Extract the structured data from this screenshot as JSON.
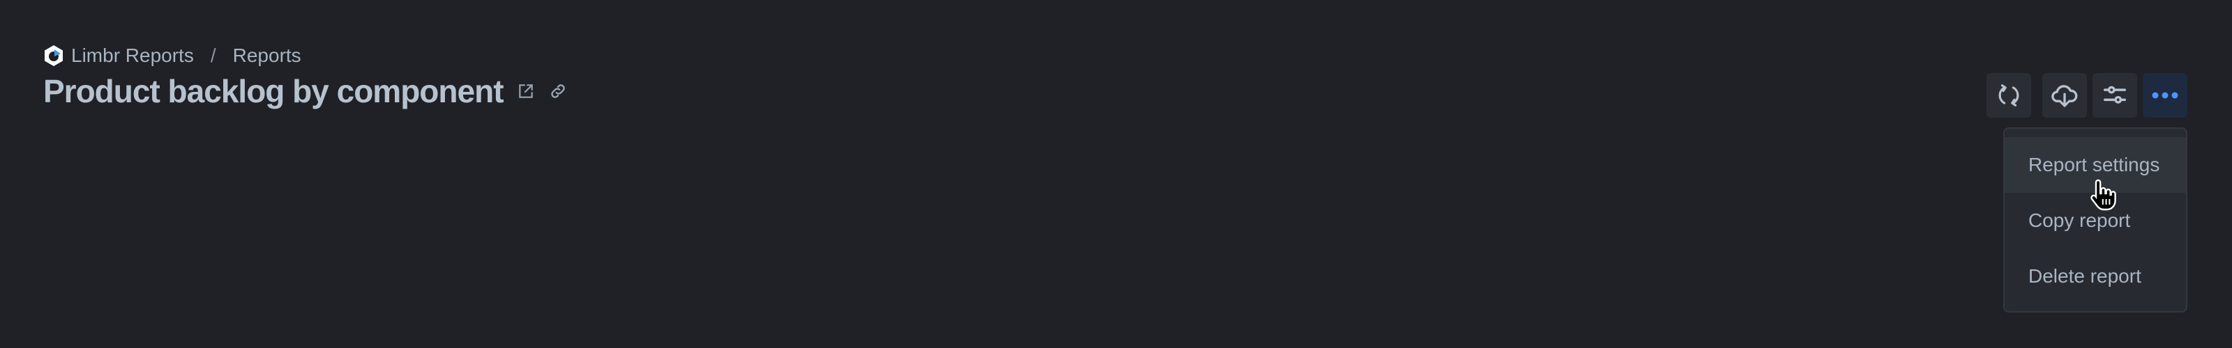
{
  "breadcrumb": {
    "app_name": "Limbr Reports",
    "separator": "/",
    "section": "Reports",
    "logo_icon": "limbr-logo-icon"
  },
  "page": {
    "title": "Product backlog by component",
    "title_icons": [
      "external-link-icon",
      "link-icon"
    ]
  },
  "toolbar": {
    "buttons": [
      {
        "name": "refresh",
        "icon": "refresh-icon",
        "active": false
      },
      {
        "name": "download",
        "icon": "cloud-download-icon",
        "active": false
      },
      {
        "name": "filters",
        "icon": "sliders-icon",
        "active": false
      },
      {
        "name": "more",
        "icon": "more-horizontal-icon",
        "active": true
      }
    ],
    "accent_color": "#4d94ff"
  },
  "menu": {
    "items": [
      {
        "label": "Report settings",
        "hovered": true
      },
      {
        "label": "Copy report",
        "hovered": false
      },
      {
        "label": "Delete report",
        "hovered": false
      }
    ]
  }
}
